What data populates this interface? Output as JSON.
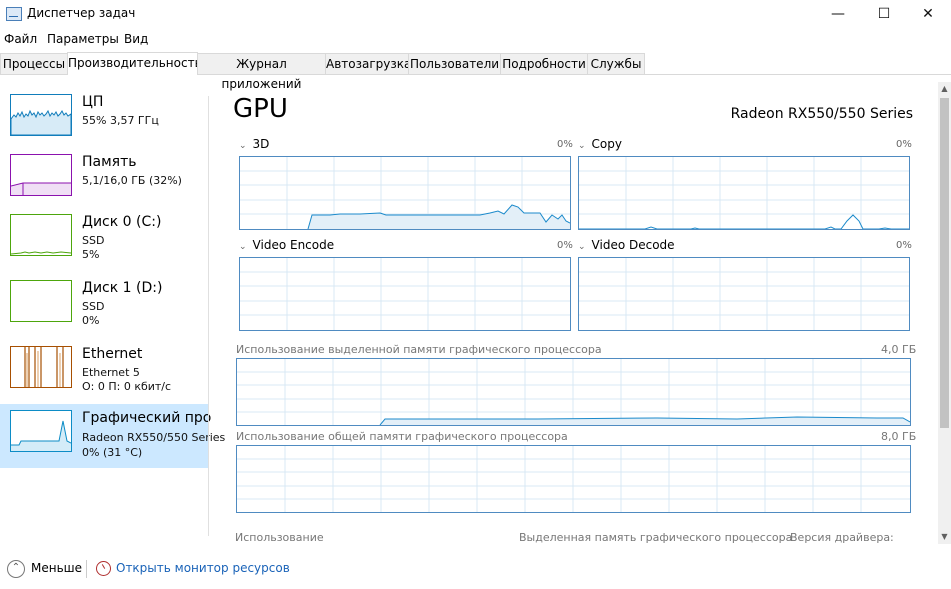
{
  "window": {
    "title": "Диспетчер задач",
    "controls": [
      "—",
      "☐",
      "✕"
    ]
  },
  "menu": [
    "Файл",
    "Параметры",
    "Вид"
  ],
  "tabs": [
    {
      "label": "Процессы"
    },
    {
      "label": "Производительность"
    },
    {
      "label": "Журнал приложений"
    },
    {
      "label": "Автозагрузка"
    },
    {
      "label": "Пользователи"
    },
    {
      "label": "Подробности"
    },
    {
      "label": "Службы"
    }
  ],
  "sidebar": {
    "items": [
      {
        "title": "ЦП",
        "lines": [
          "55% 3,57 ГГц"
        ],
        "color": "#117dbb"
      },
      {
        "title": "Память",
        "lines": [
          "5,1/16,0 ГБ (32%)"
        ],
        "color": "#8b12ae"
      },
      {
        "title": "Диск 0 (C:)",
        "lines": [
          "SSD",
          "5%"
        ],
        "color": "#4da60c"
      },
      {
        "title": "Диск 1 (D:)",
        "lines": [
          "SSD",
          "0%"
        ],
        "color": "#4da60c"
      },
      {
        "title": "Ethernet",
        "lines": [
          "Ethernet 5",
          "О: 0 П: 0 кбит/с"
        ],
        "color": "#a74f01"
      },
      {
        "title": "Графический про",
        "lines": [
          "Radeon RX550/550 Series",
          "0% (31 °C)"
        ],
        "color": "#0c8cc6"
      }
    ]
  },
  "main": {
    "title": "GPU",
    "gpu_name": "Radeon RX550/550 Series",
    "engines": [
      {
        "label": "3D",
        "percent": "0%"
      },
      {
        "label": "Copy",
        "percent": "0%"
      },
      {
        "label": "Video Encode",
        "percent": "0%"
      },
      {
        "label": "Video Decode",
        "percent": "0%"
      }
    ],
    "dedicated_memory": {
      "label": "Использование выделенной памяти графического процессора",
      "max": "4,0 ГБ"
    },
    "shared_memory": {
      "label": "Использование общей памяти графического процессора",
      "max": "8,0 ГБ"
    },
    "bottom_labels": {
      "usage": "Использование",
      "dedicated": "Выделенная память графического процессора",
      "driver": "Версия драйвера:"
    }
  },
  "footer": {
    "fewer_label": "Меньше",
    "resource_monitor_label": "Открыть монитор ресурсов"
  }
}
